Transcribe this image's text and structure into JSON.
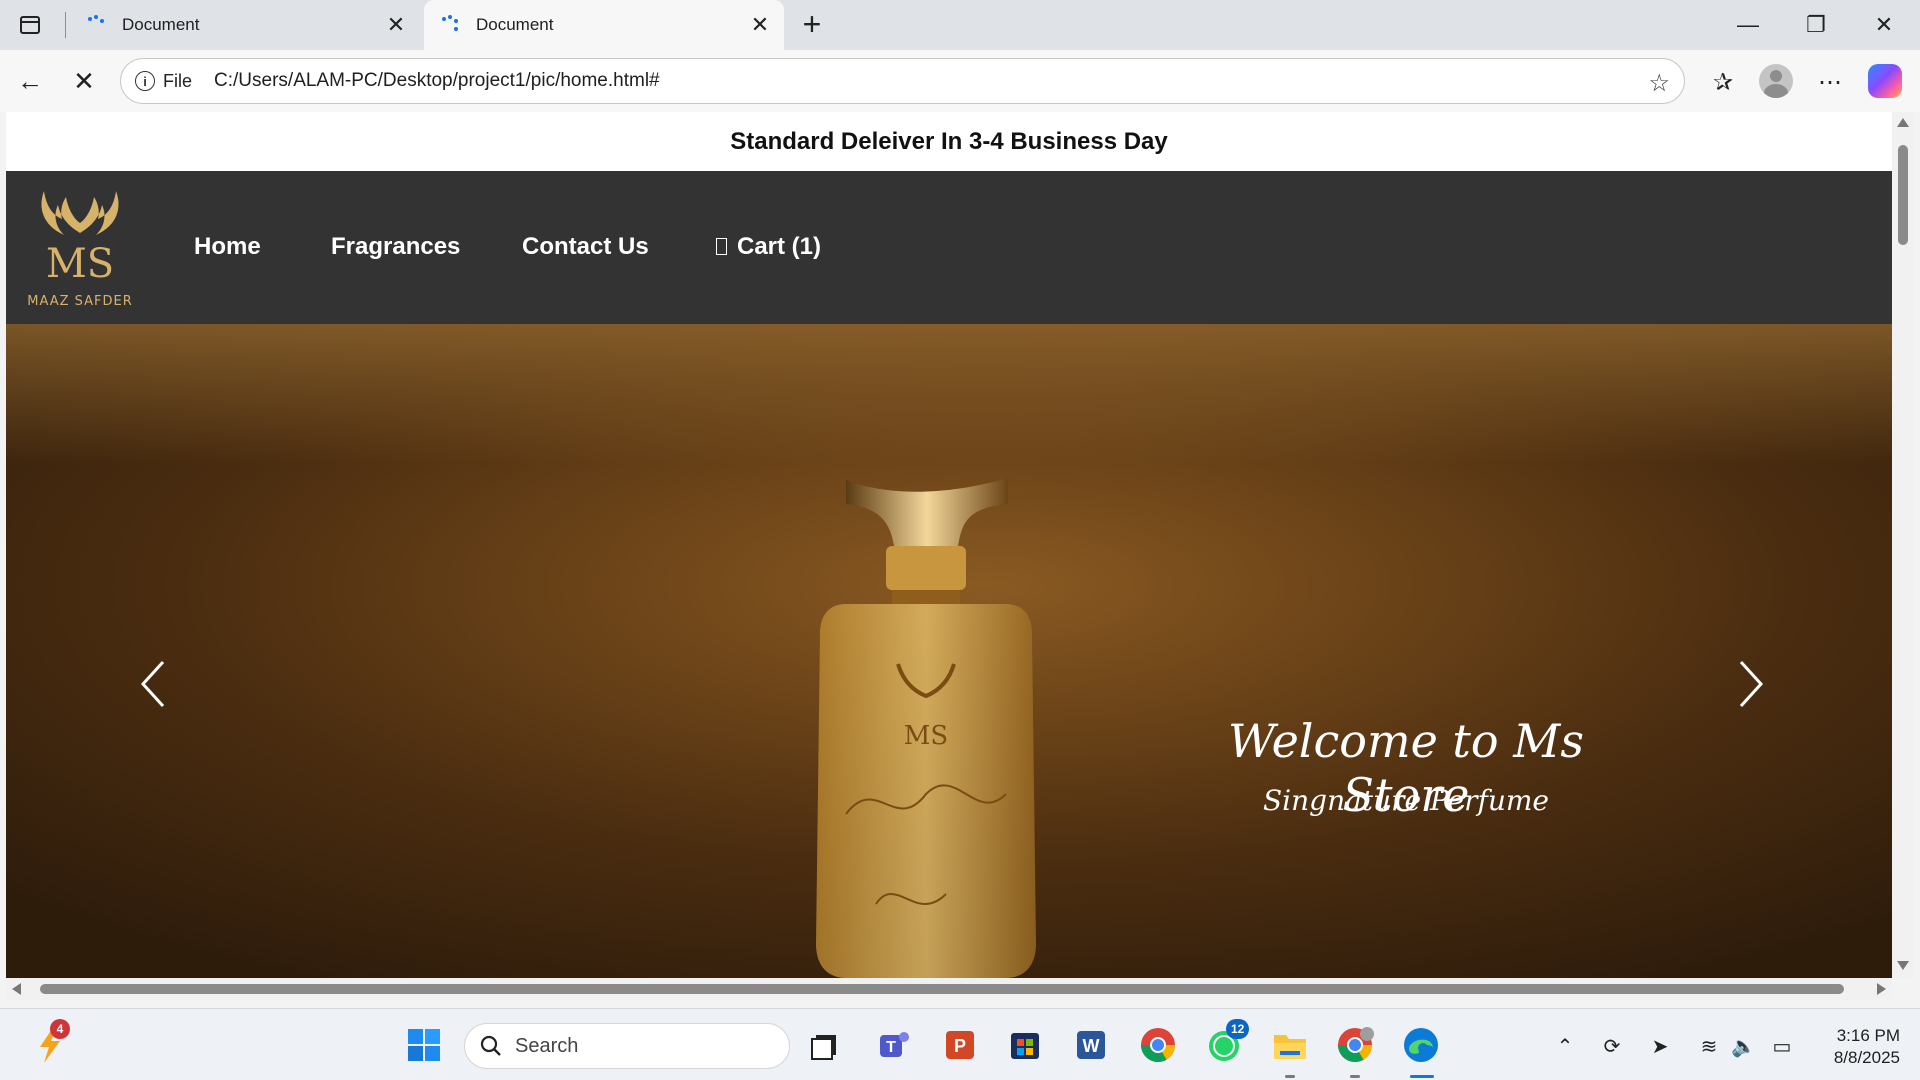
{
  "browser": {
    "tabs": [
      {
        "title": "Document"
      },
      {
        "title": "Document"
      }
    ],
    "address": {
      "scheme_label": "File",
      "url": "C:/Users/ALAM-PC/Desktop/project1/pic/home.html#"
    }
  },
  "page": {
    "announcement": "Standard Deleiver In 3-4 Business Day",
    "logo_text": "MAAZ SAFDER",
    "nav": {
      "home": "Home",
      "fragrances": "Fragrances",
      "contact": "Contact Us",
      "cart": "Cart (1)"
    },
    "hero": {
      "title": "Welcome to Ms Store",
      "subtitle": "Singnature Perfume"
    }
  },
  "taskbar": {
    "search_placeholder": "Search",
    "notification_count": "4",
    "whatsapp_count": "12",
    "time": "3:16 PM",
    "date": "8/8/2025"
  },
  "colors": {
    "nav_bg": "#333333",
    "gold": "#d6b26a",
    "accent": "#1a73e8"
  }
}
